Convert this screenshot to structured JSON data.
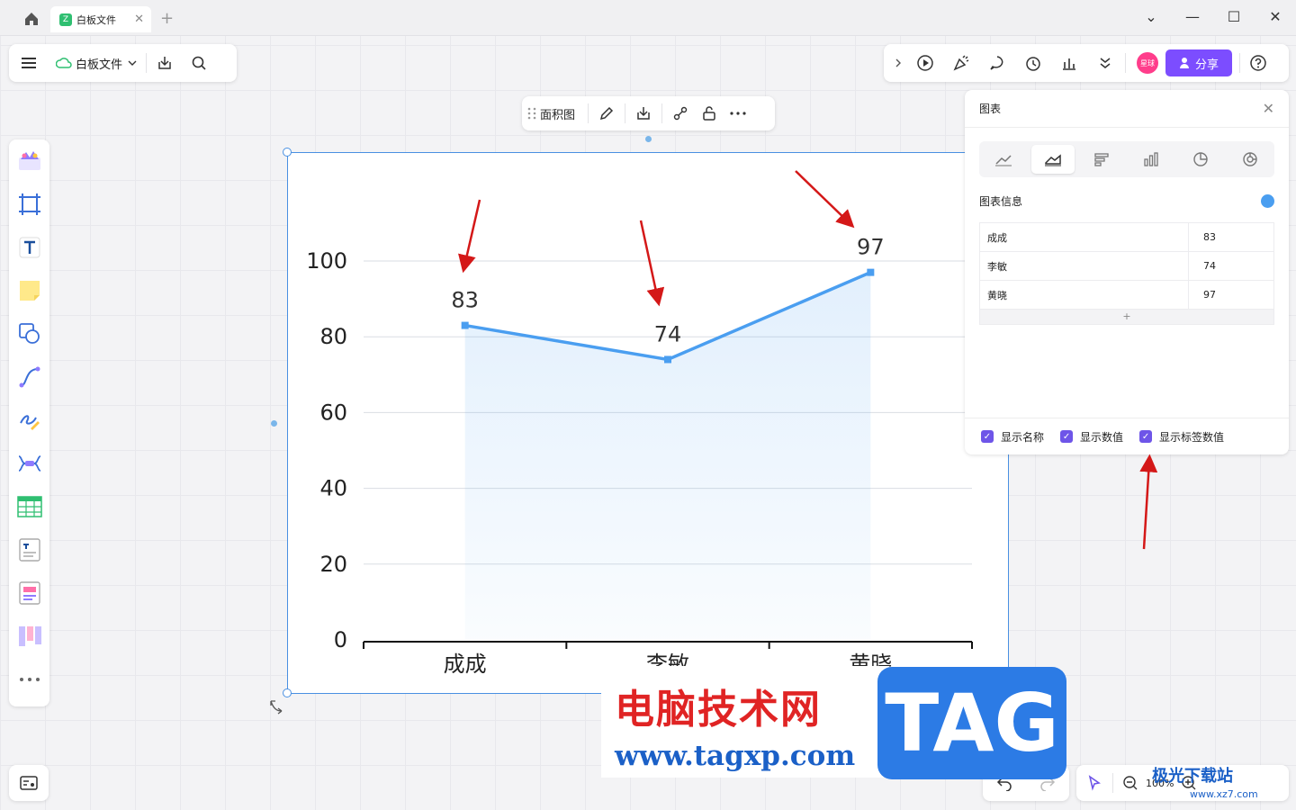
{
  "titlebar": {
    "tab_title": "白板文件",
    "tab_logo": "Z",
    "tab_close": "✕",
    "tab_add": "+",
    "controls": [
      "⌄",
      "—",
      "☐",
      "✕"
    ]
  },
  "file_toolbar": {
    "file_name": "白板文件"
  },
  "top_right": {
    "share_label": "分享",
    "avatar_text": "星球"
  },
  "float_toolbar": {
    "chart_type_label": "面积图"
  },
  "chart_panel": {
    "title": "图表",
    "close": "✕",
    "section_title": "图表信息",
    "rows": [
      {
        "name": "成成",
        "value": "83"
      },
      {
        "name": "李敏",
        "value": "74"
      },
      {
        "name": "黄晓",
        "value": "97"
      }
    ],
    "add_label": "+",
    "options": [
      {
        "label": "显示名称",
        "checked": true
      },
      {
        "label": "显示数值",
        "checked": true
      },
      {
        "label": "显示标签数值",
        "checked": true
      }
    ]
  },
  "zoom": {
    "level": "100%"
  },
  "watermark": {
    "title": "电脑技术网",
    "url": "www.tagxp.com",
    "tag": "TAG",
    "right_logo": "极光下载站",
    "right_url": "www.xz7.com"
  },
  "chart_data": {
    "type": "area",
    "categories": [
      "成成",
      "李敏",
      "黄晓"
    ],
    "values": [
      83,
      74,
      97
    ],
    "data_labels": [
      "83",
      "74",
      "97"
    ],
    "yticks": [
      "0",
      "20",
      "40",
      "60",
      "80",
      "100"
    ],
    "ylim": [
      0,
      100
    ],
    "title": "",
    "xlabel": "",
    "ylabel": "",
    "grid": true,
    "color": "#4a9ef0"
  }
}
